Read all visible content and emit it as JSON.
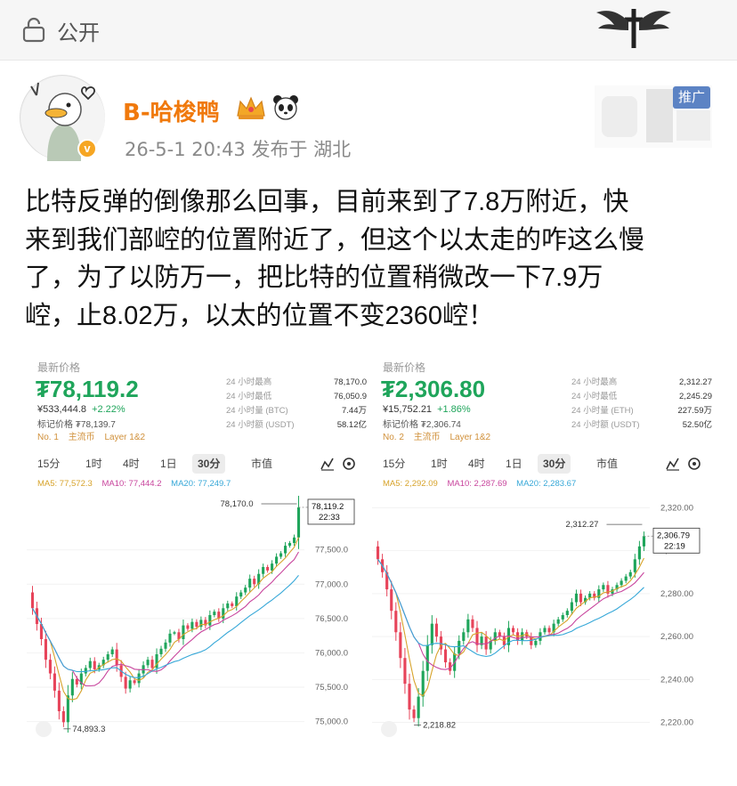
{
  "visibility": {
    "label": "公开",
    "icon": "lock-icon"
  },
  "author": {
    "name": "B-哈梭鸭",
    "verified_icon": "v-badge-icon",
    "badge_icons": [
      "crown-icon",
      "panda-icon"
    ],
    "meta": "26-5-1 20:43  发布于 湖北"
  },
  "promo": {
    "label": "推广"
  },
  "post": {
    "lines": [
      "比特反弹的倒像那么回事，目前来到了7.8万附近，快",
      "来到我们部崆的位置附近了，但这个以太走的咋这么慢",
      "了，为了以防万一，把比特的位置稍微改一下7.9万",
      "崆，止8.02万，以太的位置不变2360崆！"
    ]
  },
  "colors": {
    "up": "#1fa55b",
    "down": "#e7445a",
    "ma5": "#d7a32b",
    "ma10": "#c8459d",
    "ma20": "#37a8d8",
    "accent": "#f0790c"
  },
  "btc": {
    "latest_label": "最新价格",
    "price": "₮78,119.2",
    "cny": "¥533,444.8",
    "change": "+2.22%",
    "mark": "标记价格 ₮78,139.7",
    "tags": [
      "No. 1",
      "主流币",
      "Layer 1&2"
    ],
    "stats": [
      {
        "k": "24 小时最高",
        "v": "78,170.0"
      },
      {
        "k": "24 小时最低",
        "v": "76,050.9"
      },
      {
        "k": "24 小时量 (BTC)",
        "v": "7.44万"
      },
      {
        "k": "24 小时额 (USDT)",
        "v": "58.12亿"
      }
    ],
    "tabs": [
      "15分",
      "1时",
      "4时",
      "1日",
      "30分",
      "市值"
    ],
    "ma": {
      "ma5": "MA5: 77,572.3",
      "ma10": "MA10: 77,444.2",
      "ma20": "MA20: 77,249.7"
    },
    "high_label": "78,170.0",
    "current_label": "78,119.2",
    "countdown": "22:33",
    "low_label": "74,893.3"
  },
  "eth": {
    "latest_label": "最新价格",
    "price": "₮2,306.80",
    "cny": "¥15,752.21",
    "change": "+1.86%",
    "mark": "标记价格 ₮2,306.74",
    "tags": [
      "No. 2",
      "主流币",
      "Layer 1&2"
    ],
    "stats": [
      {
        "k": "24 小时最高",
        "v": "2,312.27"
      },
      {
        "k": "24 小时最低",
        "v": "2,245.29"
      },
      {
        "k": "24 小时量 (ETH)",
        "v": "227.59万"
      },
      {
        "k": "24 小时额 (USDT)",
        "v": "52.50亿"
      }
    ],
    "tabs": [
      "15分",
      "1时",
      "4时",
      "1日",
      "30分",
      "市值"
    ],
    "ma": {
      "ma5": "MA5: 2,292.09",
      "ma10": "MA10: 2,287.69",
      "ma20": "MA20: 2,283.67"
    },
    "high_label": "2,312.27",
    "current_label": "2,306.79",
    "countdown": "22:19",
    "low_label": "2,218.82"
  },
  "chart_data": [
    {
      "type": "candlestick",
      "title": "BTC 30分",
      "y_ticks": [
        "77,500.0",
        "77,000.0",
        "76,500.0",
        "76,000.0",
        "75,500.0",
        "75,000.0"
      ],
      "ylim": [
        74800,
        78300
      ],
      "high": 78170.0,
      "low": 74893.3,
      "last": 78119.2,
      "close": [
        76650,
        76420,
        76200,
        75900,
        75700,
        75450,
        75150,
        74990,
        75380,
        75620,
        75540,
        75700,
        75780,
        75880,
        75760,
        75820,
        75900,
        75980,
        76050,
        75820,
        75650,
        75480,
        75600,
        75560,
        75700,
        75820,
        75900,
        75780,
        75980,
        76060,
        76150,
        76280,
        76300,
        76200,
        76400,
        76350,
        76450,
        76380,
        76480,
        76400,
        76550,
        76600,
        76500,
        76650,
        76720,
        76680,
        76820,
        76880,
        76950,
        77080,
        77000,
        77150,
        77250,
        77200,
        77300,
        77400,
        77450,
        77560,
        77600,
        77680,
        78119
      ],
      "ma20_end": 77249.7,
      "ma10_end": 77444.2,
      "ma5_end": 77572.3
    },
    {
      "type": "candlestick",
      "title": "ETH 30分",
      "y_ticks": [
        "2,320.00",
        "2,300.00",
        "2,280.00",
        "2,260.00",
        "2,240.00",
        "2,220.00"
      ],
      "ylim": [
        2214,
        2326
      ],
      "high": 2312.27,
      "low": 2218.82,
      "last": 2306.79,
      "close": [
        2296,
        2290,
        2282,
        2272,
        2262,
        2250,
        2238,
        2226,
        2222,
        2232,
        2244,
        2256,
        2266,
        2260,
        2254,
        2248,
        2244,
        2252,
        2258,
        2262,
        2268,
        2264,
        2256,
        2260,
        2254,
        2258,
        2262,
        2260,
        2256,
        2264,
        2262,
        2258,
        2262,
        2260,
        2256,
        2258,
        2262,
        2264,
        2262,
        2266,
        2268,
        2270,
        2272,
        2276,
        2280,
        2276,
        2278,
        2280,
        2278,
        2282,
        2284,
        2280,
        2282,
        2284,
        2286,
        2288,
        2290,
        2296,
        2302,
        2306.8
      ],
      "ma20_end": 2283.67,
      "ma10_end": 2287.69,
      "ma5_end": 2292.09
    }
  ]
}
